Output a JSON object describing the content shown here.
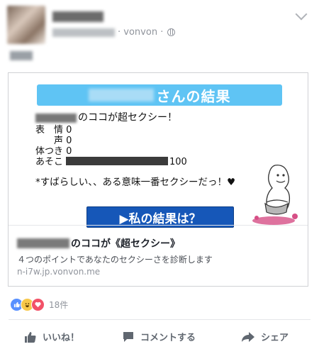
{
  "post": {
    "source": "vonvon",
    "separator_1": "·",
    "separator_2": "·"
  },
  "card": {
    "banner_text": "さんの結果",
    "result_heading": "のココが超セクシー！",
    "stats": [
      {
        "label": "表　情",
        "value": "0"
      },
      {
        "label": "　　声",
        "value": "0"
      },
      {
        "label": "体つき",
        "value": "0"
      },
      {
        "label": "あそこ",
        "value": "100"
      }
    ],
    "comment": "*すばらしい、、ある意味一番セクシーだっ！♥",
    "cta_label": "▶私の結果は？",
    "link_title": "のココが《超セクシー》",
    "link_description": "４つのポイントであなたのセクシーさを診断します",
    "link_domain": "n-i7w.jp.vonvon.me"
  },
  "reactions": {
    "count_text": "18件"
  },
  "actions": {
    "like": "いいね！",
    "comment": "コメントする",
    "share": "シェア"
  }
}
